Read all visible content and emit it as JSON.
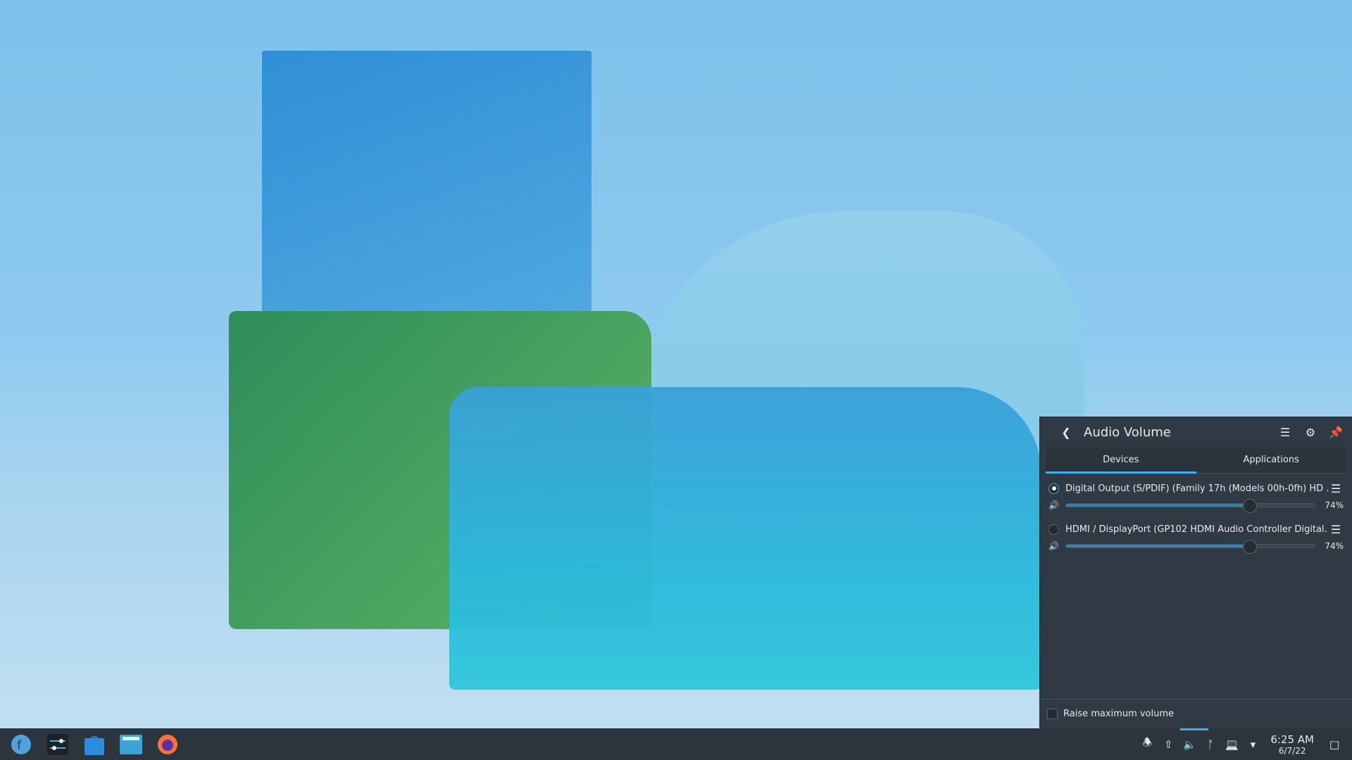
{
  "panel": {
    "title": "Audio Volume",
    "tabs": [
      {
        "label": "Devices",
        "active": true
      },
      {
        "label": "Applications",
        "active": false
      }
    ],
    "devices": [
      {
        "name": "Digital Output (S/PDIF) (Family 17h (Models 00h-0fh) HD ...",
        "selected": true,
        "volume_percent": 74,
        "volume_label": "74%"
      },
      {
        "name": "HDMI / DisplayPort (GP102 HDMI Audio Controller Digital...",
        "selected": false,
        "volume_percent": 74,
        "volume_label": "74%"
      }
    ],
    "raise_max_label": "Raise maximum volume",
    "raise_max_checked": false
  },
  "taskbar": {
    "apps": [
      "fedora-launcher-icon",
      "system-settings-icon",
      "discover-store-icon",
      "file-manager-icon",
      "firefox-icon"
    ],
    "clock": {
      "time": "6:25 AM",
      "date": "6/7/22"
    }
  },
  "colors": {
    "accent": "#3daee9",
    "panel_bg": "#2f3a44",
    "taskbar_bg": "#2c353e"
  }
}
